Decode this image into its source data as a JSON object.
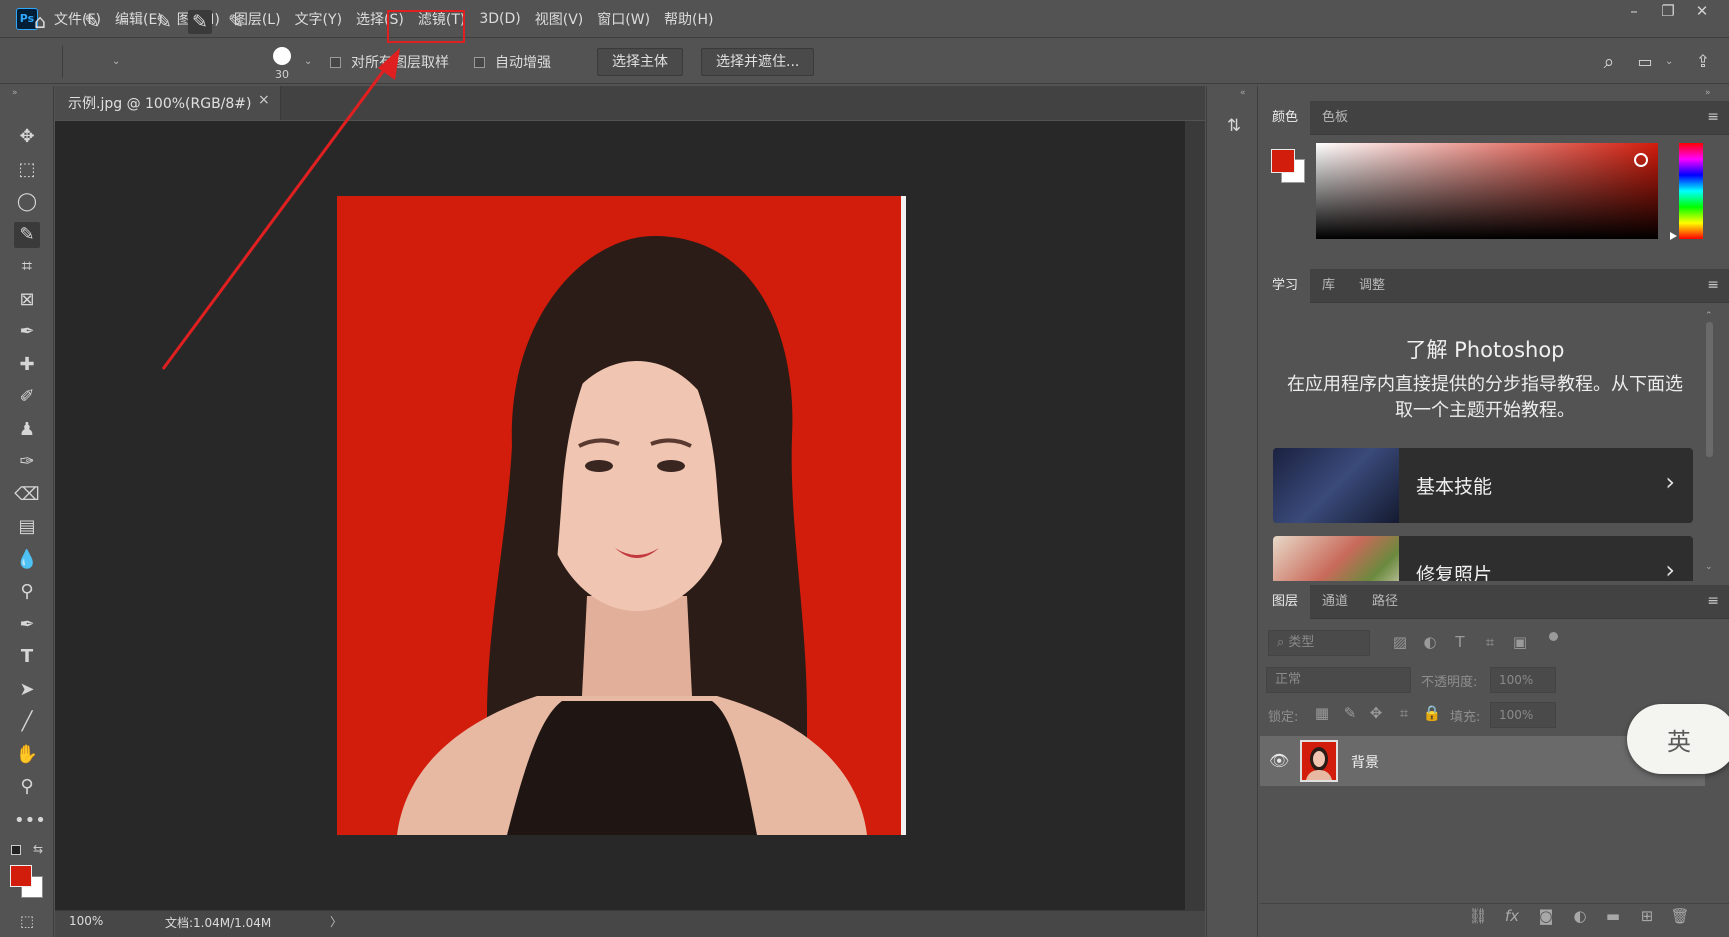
{
  "app": {
    "logo": "Ps"
  },
  "menu": {
    "items": [
      "文件(F)",
      "编辑(E)",
      "图像(I)",
      "图层(L)",
      "文字(Y)",
      "选择(S)",
      "滤镜(T)",
      "3D(D)",
      "视图(V)",
      "窗口(W)",
      "帮助(H)"
    ]
  },
  "window_controls": {
    "minimize": "–",
    "restore": "❐",
    "close": "✕"
  },
  "options": {
    "brush_size": "30",
    "sample_all_layers": "对所有图层取样",
    "auto_enhance": "自动增强",
    "select_subject": "选择主体",
    "select_and_mask": "选择并遮住..."
  },
  "document": {
    "tab_title": "示例.jpg @ 100%(RGB/8#)",
    "tab_close": "×",
    "zoom": "100%",
    "doc_info": "文档:1.04M/1.04M",
    "status_arrow": "〉"
  },
  "panels": {
    "color_tabs": [
      "颜色",
      "色板"
    ],
    "learn_tabs": [
      "学习",
      "库",
      "调整"
    ],
    "learn_title": "了解 Photoshop",
    "learn_desc": "在应用程序内直接提供的分步指导教程。从下面选取一个主题开始教程。",
    "learn_cards": [
      "基本技能",
      "修复照片"
    ],
    "layers_tabs": [
      "图层",
      "通道",
      "路径"
    ],
    "filter_kind": "类型",
    "blend_mode": "正常",
    "opacity_label": "不透明度:",
    "opacity_value": "100%",
    "lock_label": "锁定:",
    "fill_label": "填充:",
    "fill_value": "100%",
    "layer_name": "背景",
    "panel_menu": "≡"
  },
  "colors": {
    "foreground": "#d21c0c",
    "background": "#ffffff",
    "annotation": "#e02020"
  },
  "ime": {
    "char": "英"
  }
}
